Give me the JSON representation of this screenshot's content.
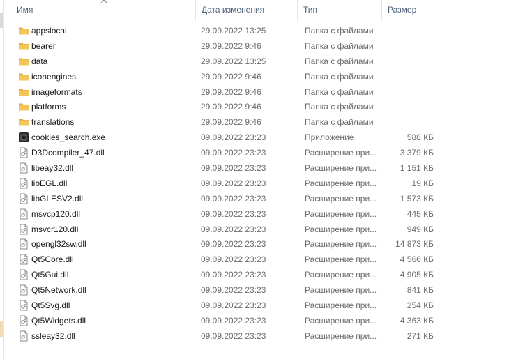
{
  "columns": {
    "name": "Имя",
    "date": "Дата изменения",
    "type": "Тип",
    "size": "Размер"
  },
  "files": [
    {
      "name": "appslocal",
      "date": "29.09.2022 13:25",
      "type": "Папка с файлами",
      "size": "",
      "icon": "folder-icon"
    },
    {
      "name": "bearer",
      "date": "29.09.2022 9:46",
      "type": "Папка с файлами",
      "size": "",
      "icon": "folder-icon"
    },
    {
      "name": "data",
      "date": "29.09.2022 13:25",
      "type": "Папка с файлами",
      "size": "",
      "icon": "folder-icon"
    },
    {
      "name": "iconengines",
      "date": "29.09.2022 9:46",
      "type": "Папка с файлами",
      "size": "",
      "icon": "folder-icon"
    },
    {
      "name": "imageformats",
      "date": "29.09.2022 9:46",
      "type": "Папка с файлами",
      "size": "",
      "icon": "folder-icon"
    },
    {
      "name": "platforms",
      "date": "29.09.2022 9:46",
      "type": "Папка с файлами",
      "size": "",
      "icon": "folder-icon"
    },
    {
      "name": "translations",
      "date": "29.09.2022 9:46",
      "type": "Папка с файлами",
      "size": "",
      "icon": "folder-icon"
    },
    {
      "name": "cookies_search.exe",
      "date": "09.09.2022 23:23",
      "type": "Приложение",
      "size": "588 КБ",
      "icon": "exe-icon"
    },
    {
      "name": "D3Dcompiler_47.dll",
      "date": "09.09.2022 23:23",
      "type": "Расширение при...",
      "size": "3 379 КБ",
      "icon": "dll-icon"
    },
    {
      "name": "libeay32.dll",
      "date": "09.09.2022 23:23",
      "type": "Расширение при...",
      "size": "1 151 КБ",
      "icon": "dll-icon"
    },
    {
      "name": "libEGL.dll",
      "date": "09.09.2022 23:23",
      "type": "Расширение при...",
      "size": "19 КБ",
      "icon": "dll-icon"
    },
    {
      "name": "libGLESV2.dll",
      "date": "09.09.2022 23:23",
      "type": "Расширение при...",
      "size": "1 573 КБ",
      "icon": "dll-icon"
    },
    {
      "name": "msvcp120.dll",
      "date": "09.09.2022 23:23",
      "type": "Расширение при...",
      "size": "445 КБ",
      "icon": "dll-icon"
    },
    {
      "name": "msvcr120.dll",
      "date": "09.09.2022 23:23",
      "type": "Расширение при...",
      "size": "949 КБ",
      "icon": "dll-icon"
    },
    {
      "name": "opengl32sw.dll",
      "date": "09.09.2022 23:23",
      "type": "Расширение при...",
      "size": "14 873 КБ",
      "icon": "dll-icon"
    },
    {
      "name": "Qt5Core.dll",
      "date": "09.09.2022 23:23",
      "type": "Расширение при...",
      "size": "4 566 КБ",
      "icon": "dll-icon"
    },
    {
      "name": "Qt5Gui.dll",
      "date": "09.09.2022 23:23",
      "type": "Расширение при...",
      "size": "4 905 КБ",
      "icon": "dll-icon"
    },
    {
      "name": "Qt5Network.dll",
      "date": "09.09.2022 23:23",
      "type": "Расширение при...",
      "size": "841 КБ",
      "icon": "dll-icon"
    },
    {
      "name": "Qt5Svg.dll",
      "date": "09.09.2022 23:23",
      "type": "Расширение при...",
      "size": "254 КБ",
      "icon": "dll-icon"
    },
    {
      "name": "Qt5Widgets.dll",
      "date": "09.09.2022 23:23",
      "type": "Расширение при...",
      "size": "4 363 КБ",
      "icon": "dll-icon"
    },
    {
      "name": "ssleay32.dll",
      "date": "09.09.2022 23:23",
      "type": "Расширение при...",
      "size": "271 КБ",
      "icon": "dll-icon"
    }
  ],
  "colors": {
    "folder": "#f4c65a",
    "folder_dark": "#e3a92f",
    "header_text": "#4c607a",
    "muted_text": "#6d6d6d"
  }
}
